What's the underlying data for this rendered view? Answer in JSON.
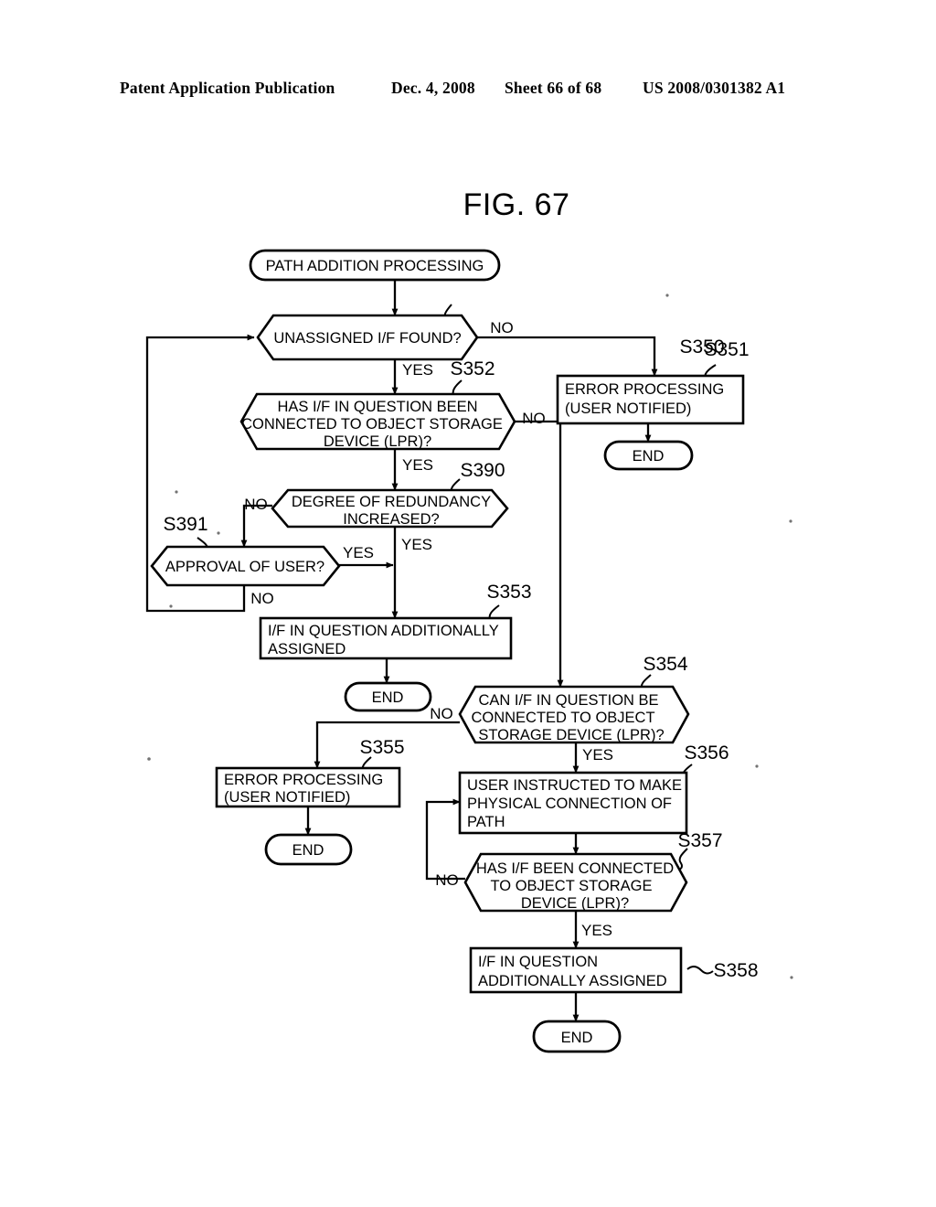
{
  "header": {
    "publication": "Patent Application Publication",
    "date": "Dec. 4, 2008",
    "sheet": "Sheet 66 of 68",
    "number": "US 2008/0301382 A1"
  },
  "figure": {
    "title": "FIG. 67"
  },
  "flowchart": {
    "start": {
      "label": "PATH ADDITION PROCESSING"
    },
    "nodes": [
      {
        "id": "S350",
        "step": "S350",
        "type": "decision",
        "label": "UNASSIGNED I/F FOUND?"
      },
      {
        "id": "S351",
        "step": "S351",
        "type": "process",
        "label_line1": "ERROR PROCESSING",
        "label_line2": "(USER NOTIFIED)"
      },
      {
        "id": "S352",
        "step": "S352",
        "type": "decision",
        "label_line1": "HAS I/F IN QUESTION BEEN",
        "label_line2": "CONNECTED TO OBJECT STORAGE",
        "label_line3": "DEVICE (LPR)?"
      },
      {
        "id": "S390",
        "step": "S390",
        "type": "decision",
        "label_line1": "DEGREE OF REDUNDANCY",
        "label_line2": "INCREASED?"
      },
      {
        "id": "S391",
        "step": "S391",
        "type": "decision",
        "label": "APPROVAL OF USER?"
      },
      {
        "id": "S353",
        "step": "S353",
        "type": "process",
        "label_line1": "I/F IN QUESTION ADDITIONALLY",
        "label_line2": "ASSIGNED"
      },
      {
        "id": "S354",
        "step": "S354",
        "type": "decision",
        "label_line1": "CAN I/F IN QUESTION BE",
        "label_line2": "CONNECTED TO OBJECT",
        "label_line3": "STORAGE DEVICE (LPR)?"
      },
      {
        "id": "S355",
        "step": "S355",
        "type": "process",
        "label_line1": "ERROR PROCESSING",
        "label_line2": "(USER NOTIFIED)"
      },
      {
        "id": "S356",
        "step": "S356",
        "type": "process",
        "label_line1": "USER INSTRUCTED TO MAKE",
        "label_line2": "PHYSICAL CONNECTION OF",
        "label_line3": "PATH"
      },
      {
        "id": "S357",
        "step": "S357",
        "type": "decision",
        "label_line1": "HAS I/F BEEN CONNECTED",
        "label_line2": "TO OBJECT STORAGE",
        "label_line3": "DEVICE (LPR)?"
      },
      {
        "id": "S358",
        "step": "S358",
        "type": "process",
        "label_line1": "I/F IN QUESTION",
        "label_line2": "ADDITIONALLY ASSIGNED"
      }
    ],
    "terminals": [
      {
        "id": "end-s351",
        "label": "END"
      },
      {
        "id": "end-s353",
        "label": "END"
      },
      {
        "id": "end-s355",
        "label": "END"
      },
      {
        "id": "end-s358",
        "label": "END"
      }
    ],
    "branch_labels": {
      "s350_no": "NO",
      "s350_yes": "YES",
      "s352_no": "NO",
      "s352_yes": "YES",
      "s390_no": "NO",
      "s390_yes": "YES",
      "s391_yes": "YES",
      "s391_no": "NO",
      "s354_no": "NO",
      "s354_yes": "YES",
      "s357_no": "NO",
      "s357_yes": "YES"
    }
  }
}
